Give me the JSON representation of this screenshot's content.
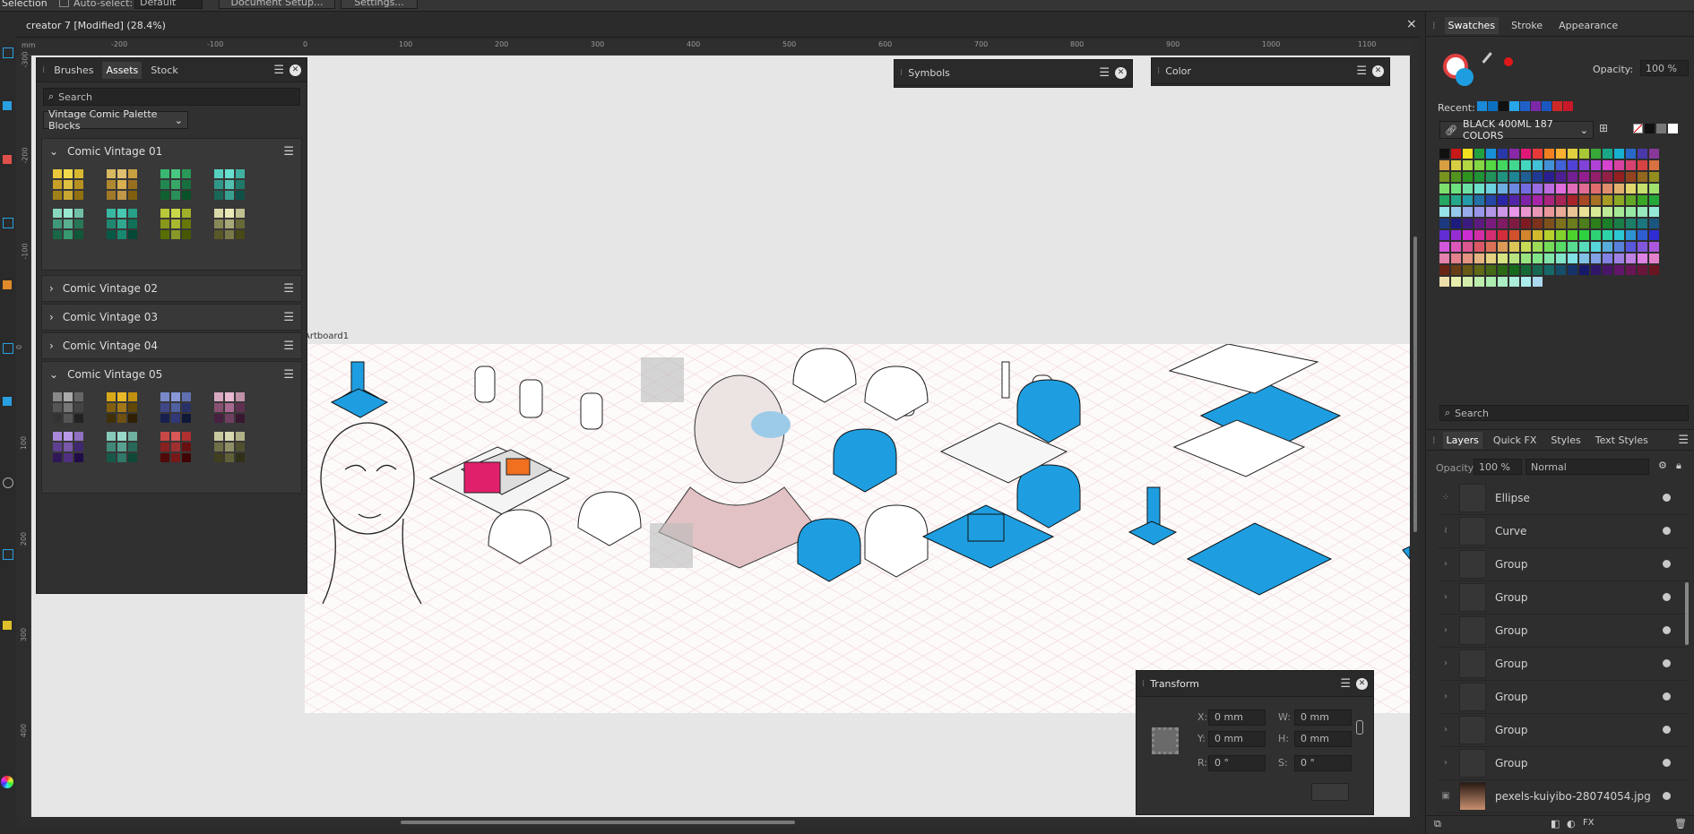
{
  "topbar": {
    "tool": "Selection",
    "auto_select_label": "Auto-select:",
    "auto_select_value": "Default",
    "document_setup": "Document Setup...",
    "settings": "Settings..."
  },
  "document": {
    "title": "creator 7 [Modified] (28.4%)",
    "close": "×"
  },
  "rulers": {
    "units": "mm",
    "h_ticks": [
      "-200",
      "-100",
      "0",
      "100",
      "200",
      "300",
      "400",
      "500",
      "600",
      "700",
      "800",
      "900",
      "1000",
      "1100"
    ],
    "v_ticks": [
      "-300",
      "-200",
      "-100",
      "0",
      "100",
      "200",
      "300",
      "400"
    ]
  },
  "assets_panel": {
    "tabs": [
      "Brushes",
      "Assets",
      "Stock"
    ],
    "active_tab": "Assets",
    "search_placeholder": "Search",
    "category": "Vintage Comic Palette Blocks",
    "sections": [
      {
        "label": "Comic Vintage 01",
        "expanded": true
      },
      {
        "label": "Comic Vintage 02",
        "expanded": false
      },
      {
        "label": "Comic Vintage 03",
        "expanded": false
      },
      {
        "label": "Comic Vintage 04",
        "expanded": false
      },
      {
        "label": "Comic Vintage 05",
        "expanded": true
      }
    ]
  },
  "symbols_panel": {
    "title": "Symbols"
  },
  "color_panel": {
    "title": "Color"
  },
  "swatches_panel": {
    "tabs": [
      "Swatches",
      "Stroke",
      "Appearance"
    ],
    "active_tab": "Swatches",
    "opacity_label": "Opacity:",
    "opacity_value": "100 %",
    "recent_label": "Recent:",
    "palette_name": "BLACK 400ML 187 COLORS",
    "search_placeholder": "Search",
    "recent_colors": [
      "#1a8ad8",
      "#0b6fc0",
      "#111111",
      "#28a6e8",
      "#2060c8",
      "#7a2aa8",
      "#1c56c0",
      "#d02828",
      "#c8182a"
    ]
  },
  "layers_panel": {
    "tabs": [
      "Layers",
      "Quick FX",
      "Styles",
      "Text Styles"
    ],
    "active_tab": "Layers",
    "opacity_label": "Opacity:",
    "opacity_value": "100 %",
    "blend_mode": "Normal",
    "layers": [
      "Ellipse",
      "Curve",
      "Group",
      "Group",
      "Group",
      "Group",
      "Group",
      "Group",
      "Group",
      "pexels-kuiyibo-28074054.jpg"
    ]
  },
  "canvas": {
    "artboard_label": "Artboard1"
  },
  "transform_panel": {
    "title": "Transform",
    "x_label": "X:",
    "x_value": "0 mm",
    "y_label": "Y:",
    "y_value": "0 mm",
    "w_label": "W:",
    "w_value": "0 mm",
    "h_label": "H:",
    "h_value": "0 mm",
    "r_label": "R:",
    "r_value": "0 °",
    "s_label": "S:",
    "s_value": "0 °"
  },
  "colors": {
    "accent_blue": "#1a9ee0",
    "panel": "#303030",
    "canvas_bg": "#e6e6e6"
  }
}
